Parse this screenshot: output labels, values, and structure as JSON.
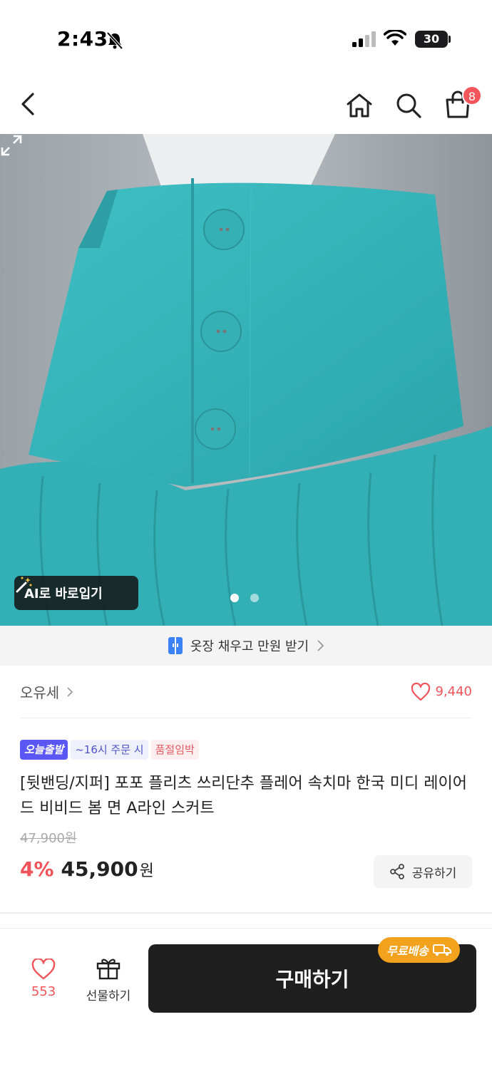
{
  "status": {
    "time": "2:43",
    "battery": "30"
  },
  "header": {
    "cart_count": "8"
  },
  "hero": {
    "ai_button_label": "AI로 바로입기",
    "page_count": 2,
    "active_page": 1
  },
  "promo": {
    "text": "옷장 채우고 만원 받기"
  },
  "brand": {
    "name": "오유세",
    "likes": "9,440"
  },
  "tags": [
    "오늘출발",
    "~16시 주문 시",
    "품절임박"
  ],
  "product": {
    "title": "[뒷밴딩/지퍼] 포포 플리츠 쓰리단추 플레어 속치마 한국 미디 레이어드 비비드 봄 면 A라인 스커트",
    "original_price": "47,900원",
    "discount": "4%",
    "price": "45,900",
    "currency": "원",
    "share_label": "공유하기"
  },
  "bottom_bar": {
    "like_count": "553",
    "gift_label": "선물하기",
    "buy_label": "구매하기",
    "shipping_badge": "무료배송"
  },
  "colors": {
    "accent": "#f0545a",
    "skirt": "#36b3b8",
    "buy_button": "#1f1f1f",
    "shipping_badge": "#f3a21d"
  }
}
